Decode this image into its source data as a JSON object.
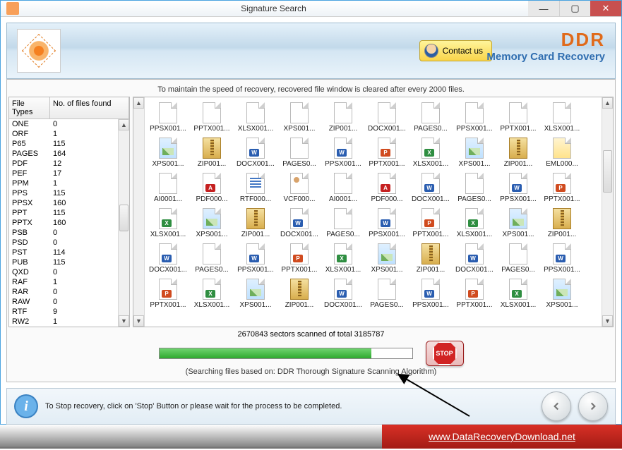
{
  "window": {
    "title": "Signature Search"
  },
  "banner": {
    "contact_label": "Contact us",
    "brand_main": "DDR",
    "brand_sub": "Memory Card Recovery"
  },
  "notice": "To maintain the speed of recovery, recovered file window is cleared after every 2000 files.",
  "filetypes": {
    "header_type": "File Types",
    "header_count": "No. of files found",
    "rows": [
      {
        "t": "ONE",
        "c": "0"
      },
      {
        "t": "ORF",
        "c": "1"
      },
      {
        "t": "P65",
        "c": "115"
      },
      {
        "t": "PAGES",
        "c": "164"
      },
      {
        "t": "PDF",
        "c": "12"
      },
      {
        "t": "PEF",
        "c": "17"
      },
      {
        "t": "PPM",
        "c": "1"
      },
      {
        "t": "PPS",
        "c": "115"
      },
      {
        "t": "PPSX",
        "c": "160"
      },
      {
        "t": "PPT",
        "c": "115"
      },
      {
        "t": "PPTX",
        "c": "160"
      },
      {
        "t": "PSB",
        "c": "0"
      },
      {
        "t": "PSD",
        "c": "0"
      },
      {
        "t": "PST",
        "c": "114"
      },
      {
        "t": "PUB",
        "c": "115"
      },
      {
        "t": "QXD",
        "c": "0"
      },
      {
        "t": "RAF",
        "c": "1"
      },
      {
        "t": "RAR",
        "c": "0"
      },
      {
        "t": "RAW",
        "c": "0"
      },
      {
        "t": "RTF",
        "c": "9"
      },
      {
        "t": "RW2",
        "c": "1"
      }
    ]
  },
  "files": {
    "rows": [
      [
        {
          "n": "PPSX001...",
          "i": "blank"
        },
        {
          "n": "PPTX001...",
          "i": "blank"
        },
        {
          "n": "XLSX001...",
          "i": "blank"
        },
        {
          "n": "XPS001...",
          "i": "blank"
        },
        {
          "n": "ZIP001...",
          "i": "blank"
        },
        {
          "n": "DOCX001...",
          "i": "blank"
        },
        {
          "n": "PAGES0...",
          "i": "blank"
        },
        {
          "n": "PPSX001...",
          "i": "blank"
        },
        {
          "n": "PPTX001...",
          "i": "blank"
        },
        {
          "n": "XLSX001...",
          "i": "blank"
        }
      ],
      [
        {
          "n": "XPS001...",
          "i": "img"
        },
        {
          "n": "ZIP001...",
          "i": "zip"
        },
        {
          "n": "DOCX001...",
          "i": "doc"
        },
        {
          "n": "PAGES0...",
          "i": "blank"
        },
        {
          "n": "PPSX001...",
          "i": "doc"
        },
        {
          "n": "PPTX001...",
          "i": "ppt"
        },
        {
          "n": "XLSX001...",
          "i": "xls"
        },
        {
          "n": "XPS001...",
          "i": "img"
        },
        {
          "n": "ZIP001...",
          "i": "zip"
        },
        {
          "n": "EML000...",
          "i": "eml"
        }
      ],
      [
        {
          "n": "AI0001...",
          "i": "blank"
        },
        {
          "n": "PDF000...",
          "i": "pdf"
        },
        {
          "n": "RTF000...",
          "i": "rtf"
        },
        {
          "n": "VCF000...",
          "i": "vcf"
        },
        {
          "n": "AI0001...",
          "i": "blank"
        },
        {
          "n": "PDF000...",
          "i": "pdf"
        },
        {
          "n": "DOCX001...",
          "i": "doc"
        },
        {
          "n": "PAGES0...",
          "i": "blank"
        },
        {
          "n": "PPSX001...",
          "i": "doc"
        },
        {
          "n": "PPTX001...",
          "i": "ppt"
        }
      ],
      [
        {
          "n": "XLSX001...",
          "i": "xls"
        },
        {
          "n": "XPS001...",
          "i": "img"
        },
        {
          "n": "ZIP001...",
          "i": "zip"
        },
        {
          "n": "DOCX001...",
          "i": "doc"
        },
        {
          "n": "PAGES0...",
          "i": "blank"
        },
        {
          "n": "PPSX001...",
          "i": "doc"
        },
        {
          "n": "PPTX001...",
          "i": "ppt"
        },
        {
          "n": "XLSX001...",
          "i": "xls"
        },
        {
          "n": "XPS001...",
          "i": "img"
        },
        {
          "n": "ZIP001...",
          "i": "zip"
        }
      ],
      [
        {
          "n": "DOCX001...",
          "i": "doc"
        },
        {
          "n": "PAGES0...",
          "i": "blank"
        },
        {
          "n": "PPSX001...",
          "i": "doc"
        },
        {
          "n": "PPTX001...",
          "i": "ppt"
        },
        {
          "n": "XLSX001...",
          "i": "xls"
        },
        {
          "n": "XPS001...",
          "i": "img"
        },
        {
          "n": "ZIP001...",
          "i": "zip"
        },
        {
          "n": "DOCX001...",
          "i": "doc"
        },
        {
          "n": "PAGES0...",
          "i": "blank"
        },
        {
          "n": "PPSX001...",
          "i": "doc"
        }
      ],
      [
        {
          "n": "PPTX001...",
          "i": "ppt"
        },
        {
          "n": "XLSX001...",
          "i": "xls"
        },
        {
          "n": "XPS001...",
          "i": "img"
        },
        {
          "n": "ZIP001...",
          "i": "zip"
        },
        {
          "n": "DOCX001...",
          "i": "doc"
        },
        {
          "n": "PAGES0...",
          "i": "blank"
        },
        {
          "n": "PPSX001...",
          "i": "doc"
        },
        {
          "n": "PPTX001...",
          "i": "ppt"
        },
        {
          "n": "XLSX001...",
          "i": "xls"
        },
        {
          "n": "XPS001...",
          "i": "img"
        }
      ]
    ]
  },
  "progress": {
    "text": "2670843 sectors scanned of total 3185787",
    "algo": "(Searching files based on:  DDR Thorough Signature Scanning Algorithm)",
    "stop_label": "STOP"
  },
  "footer": {
    "hint": "To Stop recovery, click on 'Stop' Button or please wait for the process to be completed."
  },
  "link": "www.DataRecoveryDownload.net"
}
